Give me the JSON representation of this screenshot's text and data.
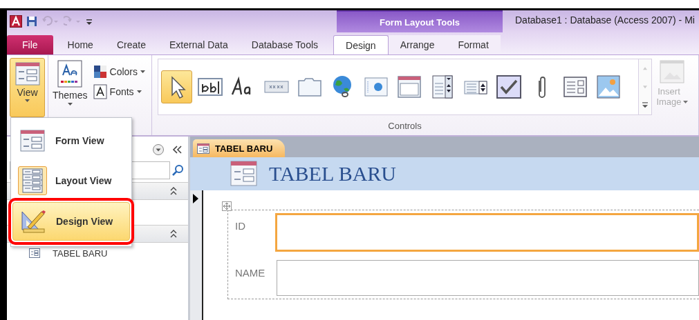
{
  "window_title": "Database1 : Database (Access 2007)  -  Mi",
  "contextual_group": "Form Layout Tools",
  "tabs": [
    {
      "label": "File",
      "kind": "file",
      "selected": false
    },
    {
      "label": "Home",
      "kind": "main",
      "selected": false
    },
    {
      "label": "Create",
      "kind": "main",
      "selected": false
    },
    {
      "label": "External Data",
      "kind": "main",
      "selected": false
    },
    {
      "label": "Database Tools",
      "kind": "main",
      "selected": false
    },
    {
      "label": "Design",
      "kind": "contextual",
      "selected": true
    },
    {
      "label": "Arrange",
      "kind": "contextual",
      "selected": false
    },
    {
      "label": "Format",
      "kind": "contextual",
      "selected": false
    }
  ],
  "view_button": {
    "label": "View",
    "pressed": true
  },
  "themes_button": "Themes",
  "colors_button": "Colors",
  "fonts_button": "Fonts",
  "controls": [
    {
      "kind": "select",
      "selected": true
    },
    {
      "kind": "textbox",
      "selected": false
    },
    {
      "kind": "label",
      "selected": false
    },
    {
      "kind": "button",
      "selected": false
    },
    {
      "kind": "tab",
      "selected": false
    },
    {
      "kind": "hyperlink",
      "selected": false
    },
    {
      "kind": "browser",
      "selected": false
    },
    {
      "kind": "navigation",
      "selected": false
    },
    {
      "kind": "combo",
      "selected": false
    },
    {
      "kind": "list",
      "selected": false
    },
    {
      "kind": "check",
      "selected": false
    },
    {
      "kind": "attachment",
      "selected": false
    },
    {
      "kind": "option",
      "selected": false
    },
    {
      "kind": "image",
      "selected": false
    }
  ],
  "controls_group_label": "Controls",
  "insert_image": {
    "label": "Insert Image",
    "disabled": true
  },
  "view_menu": [
    {
      "label": "Form View",
      "kind": "form",
      "current": false,
      "selected": false,
      "callout": false
    },
    {
      "label": "Layout View",
      "kind": "layout",
      "current": true,
      "selected": false,
      "callout": false
    },
    {
      "label": "Design View",
      "kind": "design",
      "current": false,
      "selected": true,
      "callout": true
    }
  ],
  "nav_groups": [
    {
      "expanded": true
    },
    {
      "expanded": true,
      "items": [
        {
          "label": "TABEL BARU"
        }
      ]
    }
  ],
  "document": {
    "tab": "TABEL BARU",
    "form_title": "TABEL BARU",
    "fields": [
      {
        "label": "ID",
        "focused": true
      },
      {
        "label": "NAME",
        "focused": false
      }
    ]
  }
}
